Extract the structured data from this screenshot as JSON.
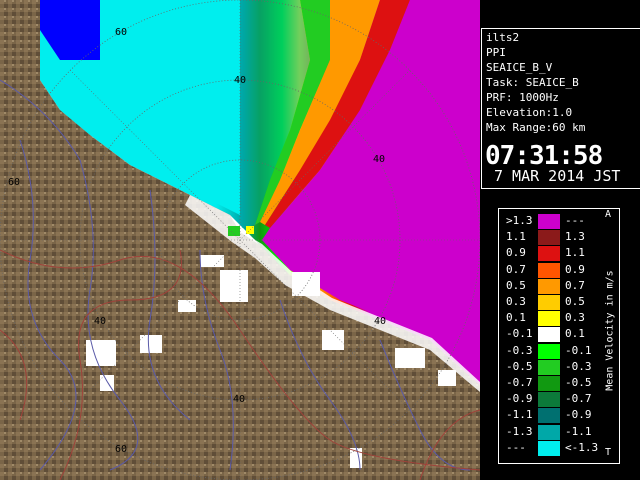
{
  "info": {
    "site": "ilts2",
    "product": "PPI",
    "field": "SEAICE_B_V",
    "task": "Task: SEAICE_B",
    "prf": "PRF: 1000Hz",
    "elevation": "Elevation:1.0",
    "max_range": "Max Range:60 km",
    "time": "07:31:58",
    "date": "7 MAR 2014 JST"
  },
  "range_rings": [
    "60",
    "40",
    "40",
    "40",
    "40",
    "40",
    "60",
    "60"
  ],
  "legend": {
    "unit_label": "Mean Velocity in m/s",
    "corner_top": "A",
    "corner_bottom": "T",
    "rows": [
      {
        "lo": ">1.3",
        "hi": "---",
        "color": "#cc00cc"
      },
      {
        "lo": "1.1",
        "hi": "1.3",
        "color": "#8b1a1a"
      },
      {
        "lo": "0.9",
        "hi": "1.1",
        "color": "#dd1111"
      },
      {
        "lo": "0.7",
        "hi": "0.9",
        "color": "#ff5500"
      },
      {
        "lo": "0.5",
        "hi": "0.7",
        "color": "#ff9900"
      },
      {
        "lo": "0.3",
        "hi": "0.5",
        "color": "#ffcc00"
      },
      {
        "lo": "0.1",
        "hi": "0.3",
        "color": "#ffff00"
      },
      {
        "lo": "-0.1",
        "hi": "0.1",
        "color": "#ffffff"
      },
      {
        "lo": "-0.3",
        "hi": "-0.1",
        "color": "#00ff00"
      },
      {
        "lo": "-0.5",
        "hi": "-0.3",
        "color": "#22cc22"
      },
      {
        "lo": "-0.7",
        "hi": "-0.5",
        "color": "#119911"
      },
      {
        "lo": "-0.9",
        "hi": "-0.7",
        "color": "#0c7a3a"
      },
      {
        "lo": "-1.1",
        "hi": "-0.9",
        "color": "#007070"
      },
      {
        "lo": "-1.3",
        "hi": "-1.1",
        "color": "#00a8a8"
      },
      {
        "lo": "---",
        "hi": "<-1.3",
        "color": "#00eeee"
      }
    ]
  },
  "colors": {
    "land": "#7a6548",
    "land_dark": "#5c4a34",
    "sea_bg": "#ffffff",
    "ring": "#666666",
    "river": "#5a5aa8",
    "border": "#a0423a"
  }
}
